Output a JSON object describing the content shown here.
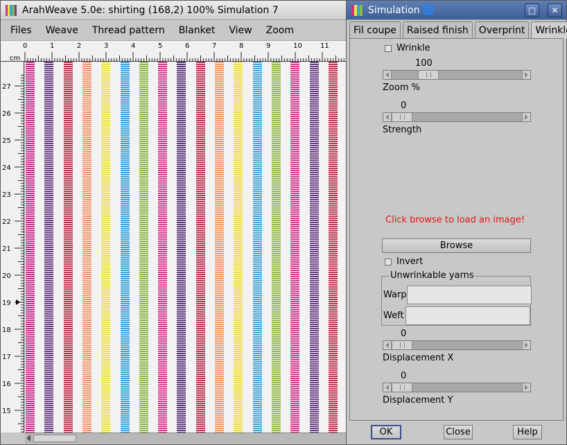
{
  "main_window": {
    "title": "ArahWeave 5.0e: shirting (168,2) 100% Simulation 7",
    "menu": [
      "Files",
      "Weave",
      "Thread pattern",
      "Blanket",
      "View",
      "Zoom"
    ],
    "ruler_unit": "cm",
    "ruler_top_labels": [
      "0",
      "1",
      "2",
      "3",
      "4",
      "5",
      "6",
      "7",
      "8",
      "9",
      "10",
      "11"
    ],
    "ruler_left_labels": [
      "27",
      "26",
      "25",
      "24",
      "23",
      "22",
      "21",
      "20",
      "19",
      "18",
      "17",
      "16",
      "15"
    ],
    "stripe_colors": [
      "#c8328f",
      "#6b3f86",
      "#b8364f",
      "#f09a73",
      "#efe04a",
      "#3aa3d6",
      "#8eb84a",
      "#d43c92",
      "#5e3a7d",
      "#bb3552",
      "#f29a6c",
      "#f0dc4c",
      "#4aa6d8",
      "#92b94a",
      "#cf3a8f",
      "#6a3f86",
      "#bc3752"
    ]
  },
  "dialog": {
    "title": "Simulation",
    "tabs": [
      "Fil coupe",
      "Raised finish",
      "Overprint",
      "Wrinkle"
    ],
    "active_tab": "Wrinkle",
    "wrinkle_checkbox": "Wrinkle",
    "zoom": {
      "value": "100",
      "label": "Zoom %",
      "fraction": 0.24
    },
    "strength": {
      "value": "0",
      "label": "Strength",
      "fraction": 0.0
    },
    "message": "Click browse to load an image!",
    "browse_button": "Browse",
    "invert_checkbox": "Invert",
    "unwrinkable": {
      "legend": "Unwrinkable yarns",
      "warp_label": "Warp",
      "warp_value": "",
      "weft_label": "Weft",
      "weft_value": ""
    },
    "displacement_x": {
      "value": "0",
      "label": "Displacement X",
      "fraction": 0.0
    },
    "displacement_y": {
      "value": "0",
      "label": "Displacement Y",
      "fraction": 0.0
    },
    "buttons": {
      "ok": "OK",
      "close": "Close",
      "help": "Help"
    }
  }
}
